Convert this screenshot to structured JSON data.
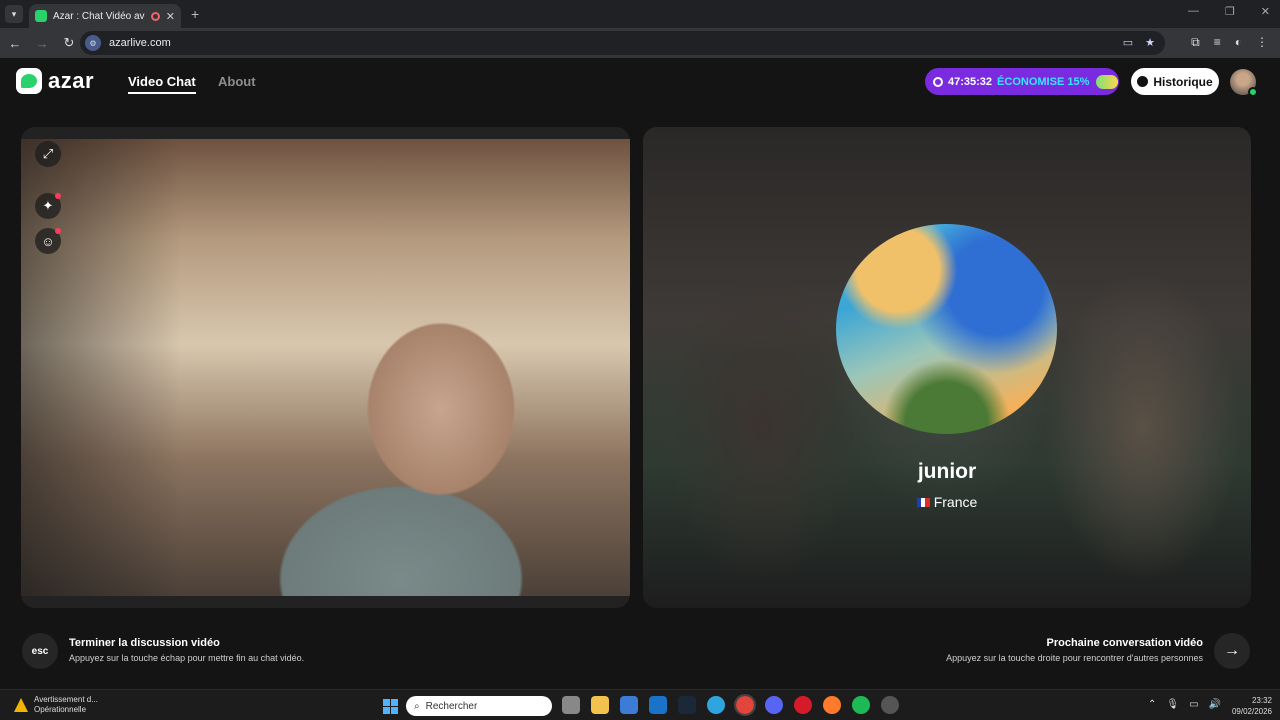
{
  "browser": {
    "tab_title": "Azar : Chat Vidéo avec de n",
    "url": "azarlive.com"
  },
  "header": {
    "logo_text": "azar",
    "nav": [
      {
        "label": "Video Chat"
      },
      {
        "label": "About"
      }
    ],
    "promo_timer": "47:35:32",
    "promo_text": "ÉCONOMISE 15%",
    "history_label": "Historique"
  },
  "peer": {
    "name": "junior",
    "country": "France"
  },
  "bottom": {
    "esc_label": "esc",
    "end_title": "Terminer la discussion vidéo",
    "end_sub": "Appuyez sur la touche échap pour mettre fin au chat vidéo.",
    "next_title": "Prochaine conversation vidéo",
    "next_sub": "Appuyez sur la touche droite pour rencontrer d'autres personnes"
  },
  "taskbar": {
    "warn_title": "Avertissement d...",
    "warn_sub": "Opérationnelle",
    "search_placeholder": "Rechercher",
    "time": "23:32",
    "date": "09/02/2026"
  },
  "colors": {
    "brand_green": "#2bd26b",
    "promo_purple": "#7a2be0",
    "promo_accent": "#35e8ff"
  }
}
